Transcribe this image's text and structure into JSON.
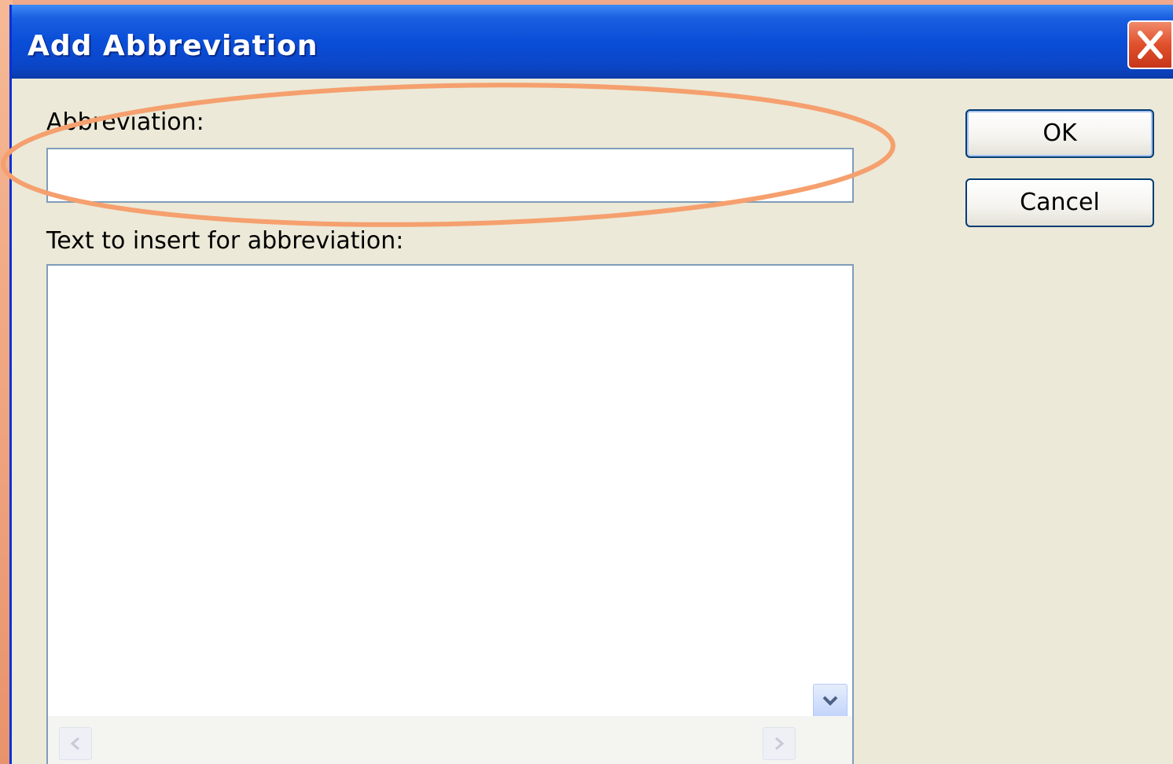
{
  "window": {
    "title": "Add Abbreviation"
  },
  "titlebar": {
    "close_icon": "close-icon"
  },
  "form": {
    "abbreviation_label": "Abbreviation:",
    "abbreviation_value": "",
    "text_label": "Text to insert for abbreviation:",
    "text_value": ""
  },
  "buttons": {
    "ok_label": "OK",
    "cancel_label": "Cancel"
  },
  "annotation": {
    "shape": "ellipse",
    "color": "#f5a06e",
    "target": "abbreviation-field"
  },
  "colors": {
    "titlebar": "#0a4ed8",
    "dialog_bg": "#ece9d8",
    "close_button": "#e0502c",
    "desktop": "#f0a98a"
  }
}
